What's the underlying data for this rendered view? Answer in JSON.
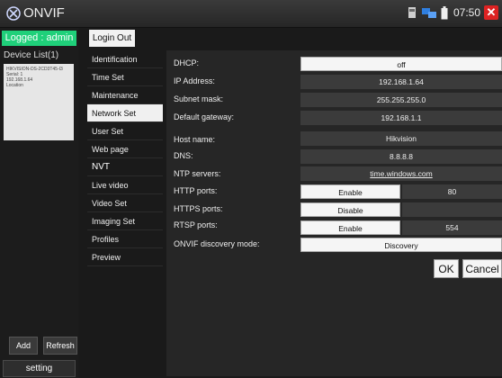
{
  "app": {
    "title": "ONVIF",
    "clock": "07:50"
  },
  "session": {
    "logged_label": "Logged : admin",
    "login_out": "Login Out"
  },
  "devices": {
    "title": "Device List(1)",
    "card": [
      "HIKVISION-DS-2CD3T45-I3",
      "Serial: 1",
      "192.168.1.64",
      "Location"
    ]
  },
  "left_buttons": {
    "add": "Add",
    "refresh": "Refresh",
    "setting": "setting"
  },
  "menu": [
    "Identification",
    "Time Set",
    "Maintenance",
    "Network Set",
    "User Set",
    "Web page",
    "NVT",
    "Live video",
    "Video Set",
    "Imaging Set",
    "Profiles",
    "Preview"
  ],
  "active_menu": "Network Set",
  "form": {
    "dhcp_label": "DHCP:",
    "dhcp_value": "off",
    "ip_label": "IP Address:",
    "ip_value": "192.168.1.64",
    "mask_label": "Subnet mask:",
    "mask_value": "255.255.255.0",
    "gateway_label": "Default gateway:",
    "gateway_value": "192.168.1.1",
    "host_label": "Host name:",
    "host_value": "Hikvision",
    "dns_label": "DNS:",
    "dns_value": "8.8.8.8",
    "ntp_label": "NTP servers:",
    "ntp_value": "time.windows.com",
    "http_label": "HTTP ports:",
    "http_state": "Enable",
    "http_port": "80",
    "https_label": "HTTPS ports:",
    "https_state": "Disable",
    "https_port": "",
    "rtsp_label": "RTSP ports:",
    "rtsp_state": "Enable",
    "rtsp_port": "554",
    "discovery_label": "ONVIF discovery mode:",
    "discovery_value": "Discovery"
  },
  "actions": {
    "ok": "OK",
    "cancel": "Cancel"
  },
  "icons": [
    "onvif-logo-icon",
    "sd-card-icon",
    "network-icon",
    "battery-icon",
    "close-icon"
  ],
  "colors": {
    "logged_bg": "#1fd07a",
    "close_bg": "#dd2222",
    "active_menu_bg": "#f0f0f0"
  }
}
